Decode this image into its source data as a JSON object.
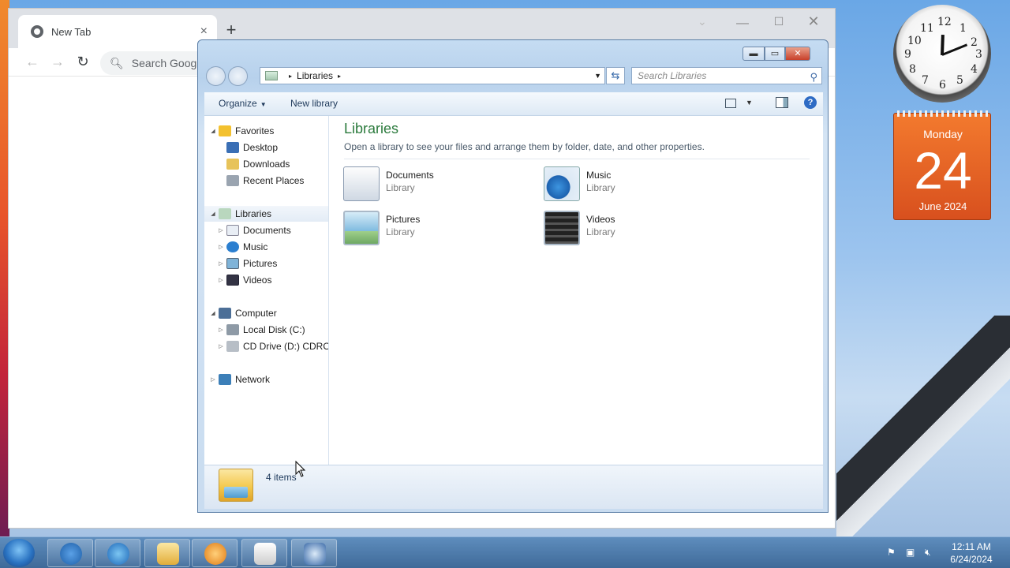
{
  "chrome": {
    "tab_title": "New Tab",
    "tab_close": "×",
    "new_tab": "+",
    "omnibox_placeholder": "Search Google",
    "min": "—",
    "max": "☐",
    "close": "✕",
    "back": "←",
    "forward": "→",
    "reload": "↻",
    "dropdown": "⌄"
  },
  "explorer": {
    "address": {
      "root_arrow": "▸",
      "crumb": "Libraries",
      "crumb_arrow": "▸"
    },
    "search_placeholder": "Search Libraries",
    "toolbar": {
      "organize": "Organize",
      "new_library": "New library",
      "help": "?"
    },
    "nav": {
      "favorites": "Favorites",
      "desktop": "Desktop",
      "downloads": "Downloads",
      "recent": "Recent Places",
      "libraries": "Libraries",
      "documents": "Documents",
      "music": "Music",
      "pictures": "Pictures",
      "videos": "Videos",
      "computer": "Computer",
      "local_disk": "Local Disk (C:)",
      "cd_drive": "CD Drive (D:) CDROM",
      "network": "Network"
    },
    "content": {
      "title": "Libraries",
      "description": "Open a library to see your files and arrange them by folder, date, and other properties.",
      "items": [
        {
          "name": "Documents",
          "type": "Library"
        },
        {
          "name": "Music",
          "type": "Library"
        },
        {
          "name": "Pictures",
          "type": "Library"
        },
        {
          "name": "Videos",
          "type": "Library"
        }
      ]
    },
    "status": "4 items"
  },
  "gadgets": {
    "clock_numbers": [
      "12",
      "1",
      "2",
      "3",
      "4",
      "5",
      "6",
      "7",
      "8",
      "9",
      "10",
      "11"
    ],
    "calendar": {
      "day": "Monday",
      "date": "24",
      "month": "June 2024"
    }
  },
  "taskbar": {
    "time": "12:11 AM",
    "date": "6/24/2024"
  }
}
